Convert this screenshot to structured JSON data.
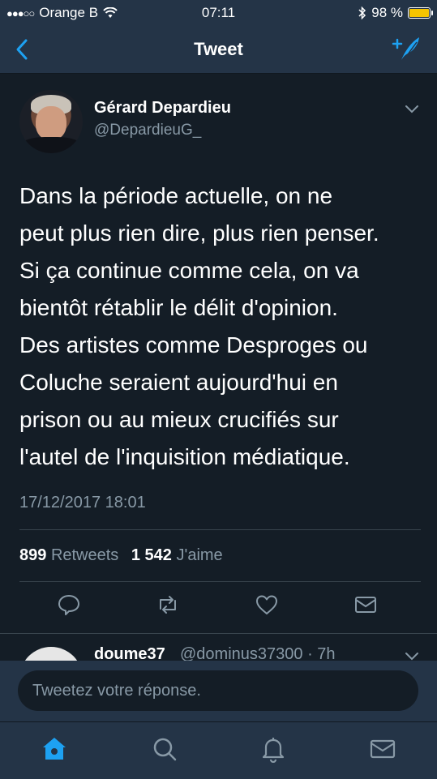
{
  "status": {
    "carrier": "Orange B",
    "time": "07:11",
    "battery": "98 %",
    "battery_level": 0.98,
    "signal_dots": "●●●○○"
  },
  "nav": {
    "title": "Tweet"
  },
  "tweet": {
    "name": "Gérard Depardieu",
    "handle": "@DepardieuG_",
    "lines": [
      "Dans la période actuelle, on ne",
      "peut plus rien dire, plus rien penser.",
      "Si ça continue comme cela, on va",
      "bientôt rétablir le délit d'opinion.",
      "Des artistes comme Desproges ou",
      "Coluche seraient aujourd'hui en",
      "prison ou au mieux crucifiés sur",
      "l'autel de l'inquisition médiatique."
    ],
    "date": "17/12/2017 18:01",
    "retweets_count": "899",
    "retweets_label": "Retweets",
    "likes_count": "1 542",
    "likes_label": "J'aime"
  },
  "reply": {
    "name": "doume37",
    "handle": "@dominus37300 · 7h"
  },
  "composer": {
    "placeholder": "Tweetez votre réponse."
  },
  "colors": {
    "accent": "#1da1f2",
    "background": "#141d26",
    "bar": "#243447",
    "muted": "#8899a6"
  },
  "icons": {
    "nav": [
      "back-chevron-icon",
      "compose-tweet-icon"
    ],
    "actions": [
      "reply-icon",
      "retweet-icon",
      "like-heart-icon",
      "direct-message-icon"
    ],
    "tabs": [
      "home-icon",
      "search-icon",
      "notifications-bell-icon",
      "messages-icon"
    ]
  }
}
